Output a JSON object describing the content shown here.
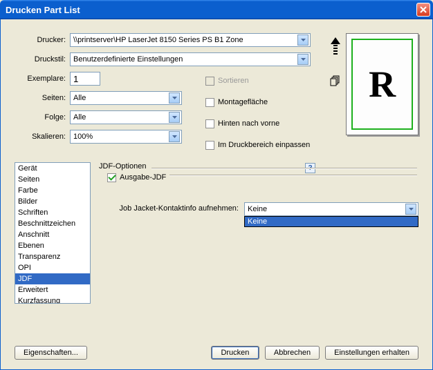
{
  "window": {
    "title": "Drucken Part List"
  },
  "form": {
    "printer_label": "Drucker:",
    "printer_value": "\\\\printserver\\HP LaserJet 8150 Series PS  B1 Zone",
    "style_label": "Druckstil:",
    "style_value": "Benutzerdefinierte Einstellungen",
    "copies_label": "Exemplare:",
    "copies_value": "1",
    "pages_label": "Seiten:",
    "pages_value": "Alle",
    "sequence_label": "Folge:",
    "sequence_value": "Alle",
    "scale_label": "Skalieren:",
    "scale_value": "100%"
  },
  "checks": {
    "collate": "Sortieren",
    "spreads": "Montagefläche",
    "back_front": "Hinten nach vorne",
    "fit_area": "Im Druckbereich einpassen"
  },
  "preview": {
    "glyph": "R",
    "help": "?"
  },
  "panes": {
    "items": [
      "Gerät",
      "Seiten",
      "Farbe",
      "Bilder",
      "Schriften",
      "Beschnittzeichen",
      "Anschnitt",
      "Ebenen",
      "Transparenz",
      "OPI",
      "JDF",
      "Erweitert",
      "Kurzfassung"
    ],
    "selected_index": 10
  },
  "jdf": {
    "group_label": "JDF-Optionen",
    "output_label": "Ausgabe-JDF",
    "job_label": "Job Jacket-Kontaktinfo aufnehmen:",
    "job_value": "Keine",
    "options": [
      "Keine"
    ]
  },
  "buttons": {
    "properties": "Eigenschaften...",
    "print": "Drucken",
    "cancel": "Abbrechen",
    "capture": "Einstellungen erhalten"
  }
}
